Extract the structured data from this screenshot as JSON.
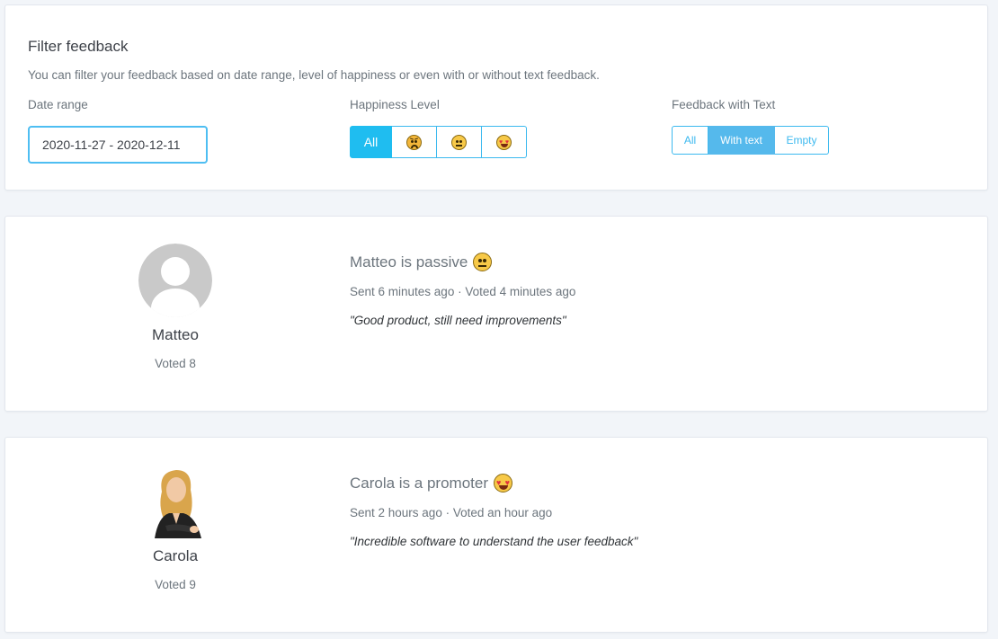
{
  "filter": {
    "title": "Filter feedback",
    "description": "You can filter your feedback based on date range, level of happiness or even with or without text feedback.",
    "date_range": {
      "label": "Date range",
      "value": "2020-11-27 - 2020-12-11"
    },
    "happiness": {
      "label": "Happiness Level",
      "options": [
        {
          "label": "All",
          "active": true
        },
        {
          "icon": "angry-face-icon",
          "active": false
        },
        {
          "icon": "neutral-face-icon",
          "active": false
        },
        {
          "icon": "heart-eyes-face-icon",
          "active": false
        }
      ]
    },
    "text_feedback": {
      "label": "Feedback with Text",
      "options": [
        {
          "label": "All",
          "active": false
        },
        {
          "label": "With text",
          "active": true
        },
        {
          "label": "Empty",
          "active": false
        }
      ]
    }
  },
  "feedback": [
    {
      "name": "Matteo",
      "voted": "Voted 8",
      "headline": "Matteo is passive",
      "sentiment_icon": "neutral-face-icon",
      "meta": "Sent 6 minutes ago · Voted 4 minutes ago",
      "quote": "\"Good product, still need improvements\"",
      "avatar": "default-avatar-icon"
    },
    {
      "name": "Carola",
      "voted": "Voted 9",
      "headline": "Carola is a promoter",
      "sentiment_icon": "heart-eyes-face-icon",
      "meta": "Sent 2 hours ago · Voted an hour ago",
      "quote": "\"Incredible software to understand the user feedback\"",
      "avatar": "user-photo"
    }
  ],
  "colors": {
    "accent": "#1fbdf0",
    "accent_light": "#55b9ec",
    "background": "#f2f5f9",
    "card": "#ffffff"
  }
}
